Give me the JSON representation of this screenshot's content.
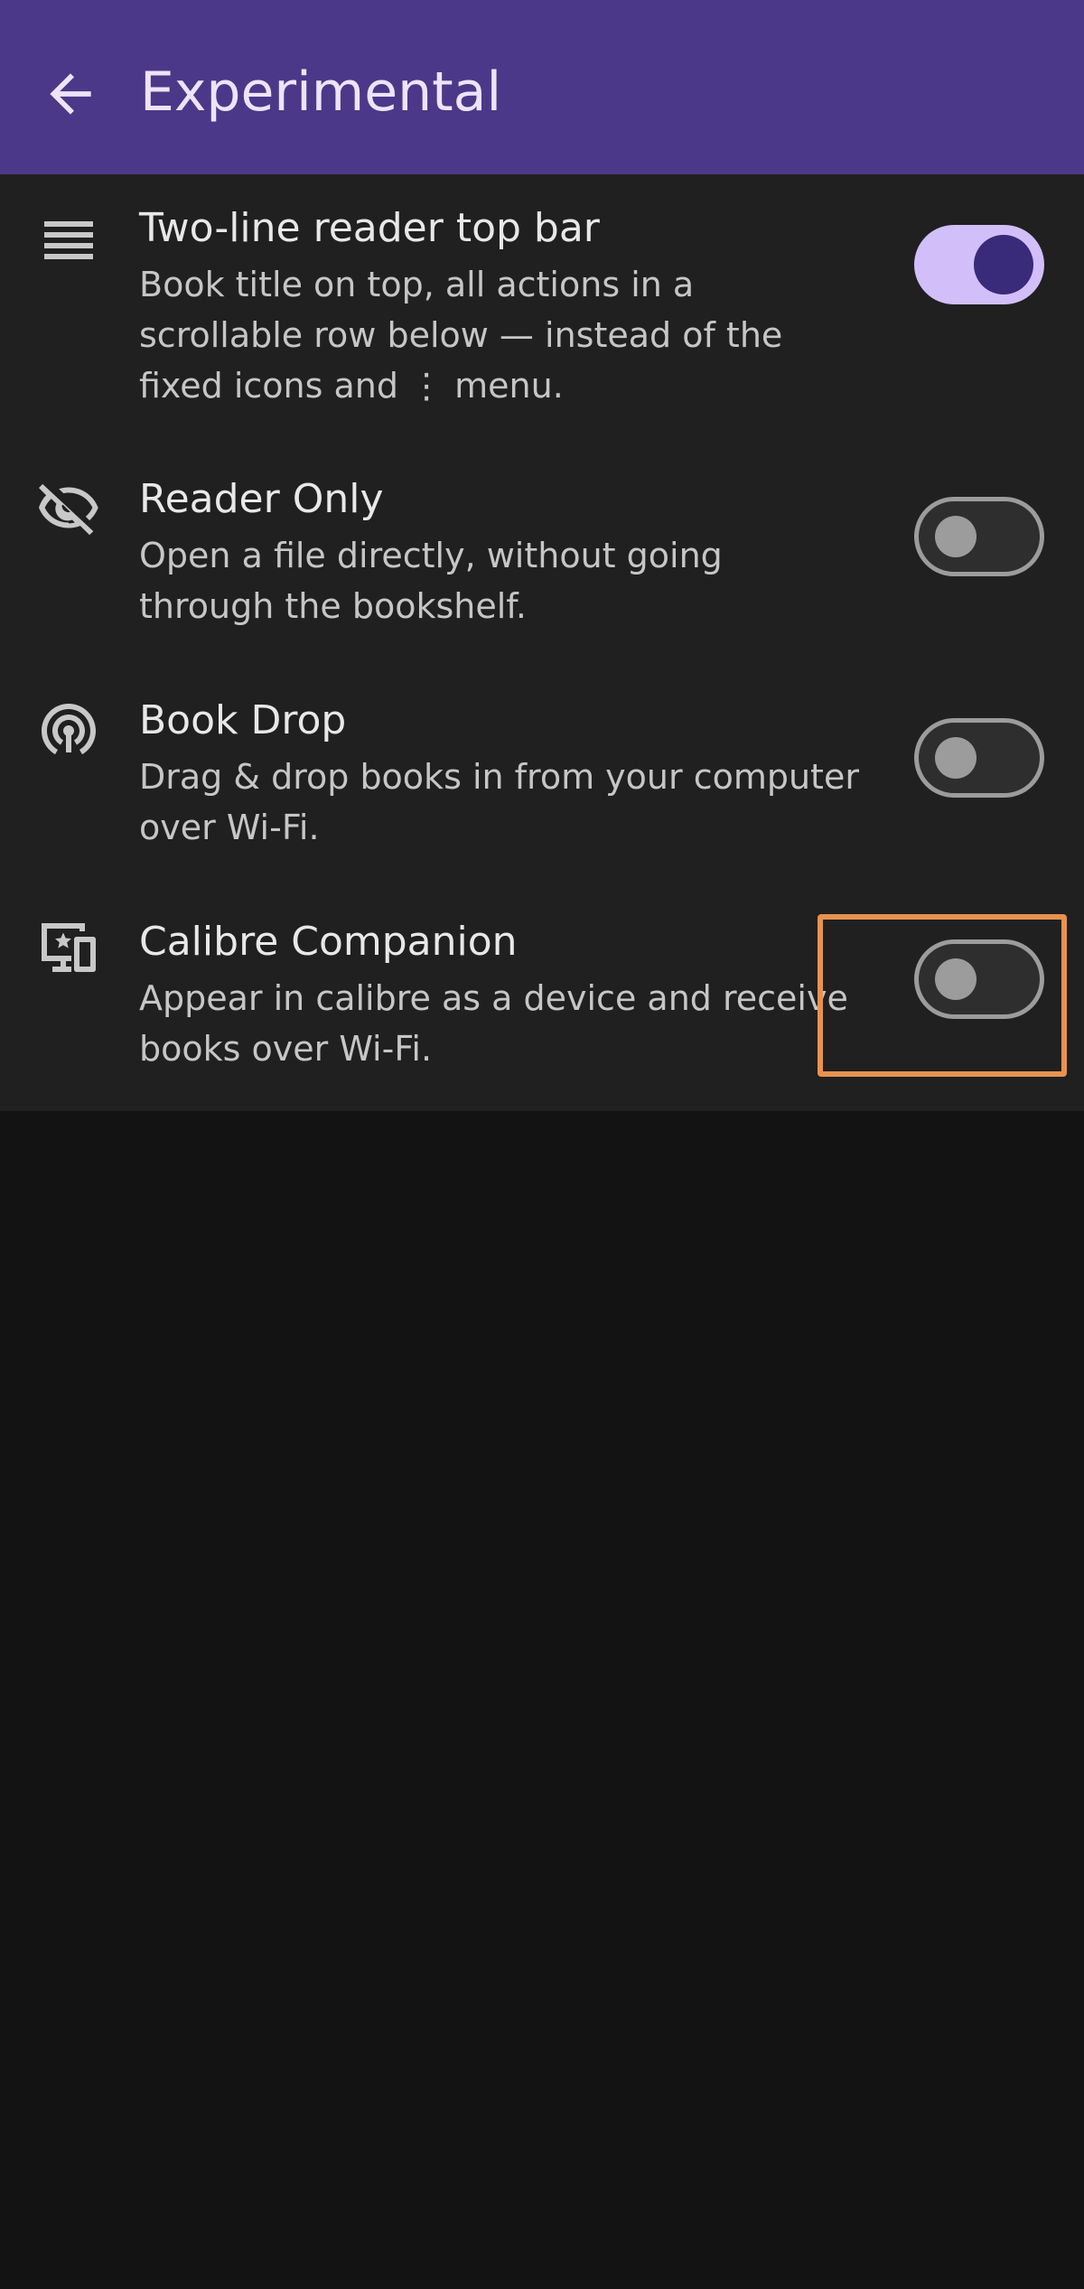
{
  "appbar": {
    "title": "Experimental",
    "back_icon": "arrow-back-icon",
    "background": "#4b3888"
  },
  "settings": [
    {
      "icon": "lines-icon",
      "title": "Two-line reader top bar",
      "description": "Book title on top, all actions in a scrollable row below — instead of the fixed icons and ⋮ menu.",
      "enabled": true
    },
    {
      "icon": "eye-off-icon",
      "title": "Reader Only",
      "description": "Open a file directly, without going through the bookshelf.",
      "enabled": false
    },
    {
      "icon": "wifi-broadcast-icon",
      "title": "Book Drop",
      "description": "Drag & drop books in from your computer over Wi-Fi.",
      "enabled": false
    },
    {
      "icon": "devices-star-icon",
      "title": "Calibre Companion",
      "description": "Appear in calibre as a device and receive books over Wi-Fi.",
      "enabled": false
    }
  ],
  "colors": {
    "switch_on_track": "#d2bffa",
    "switch_on_knob": "#3a2a7a",
    "switch_off_outline": "#9c9c9c",
    "highlight": "#e8924e"
  }
}
